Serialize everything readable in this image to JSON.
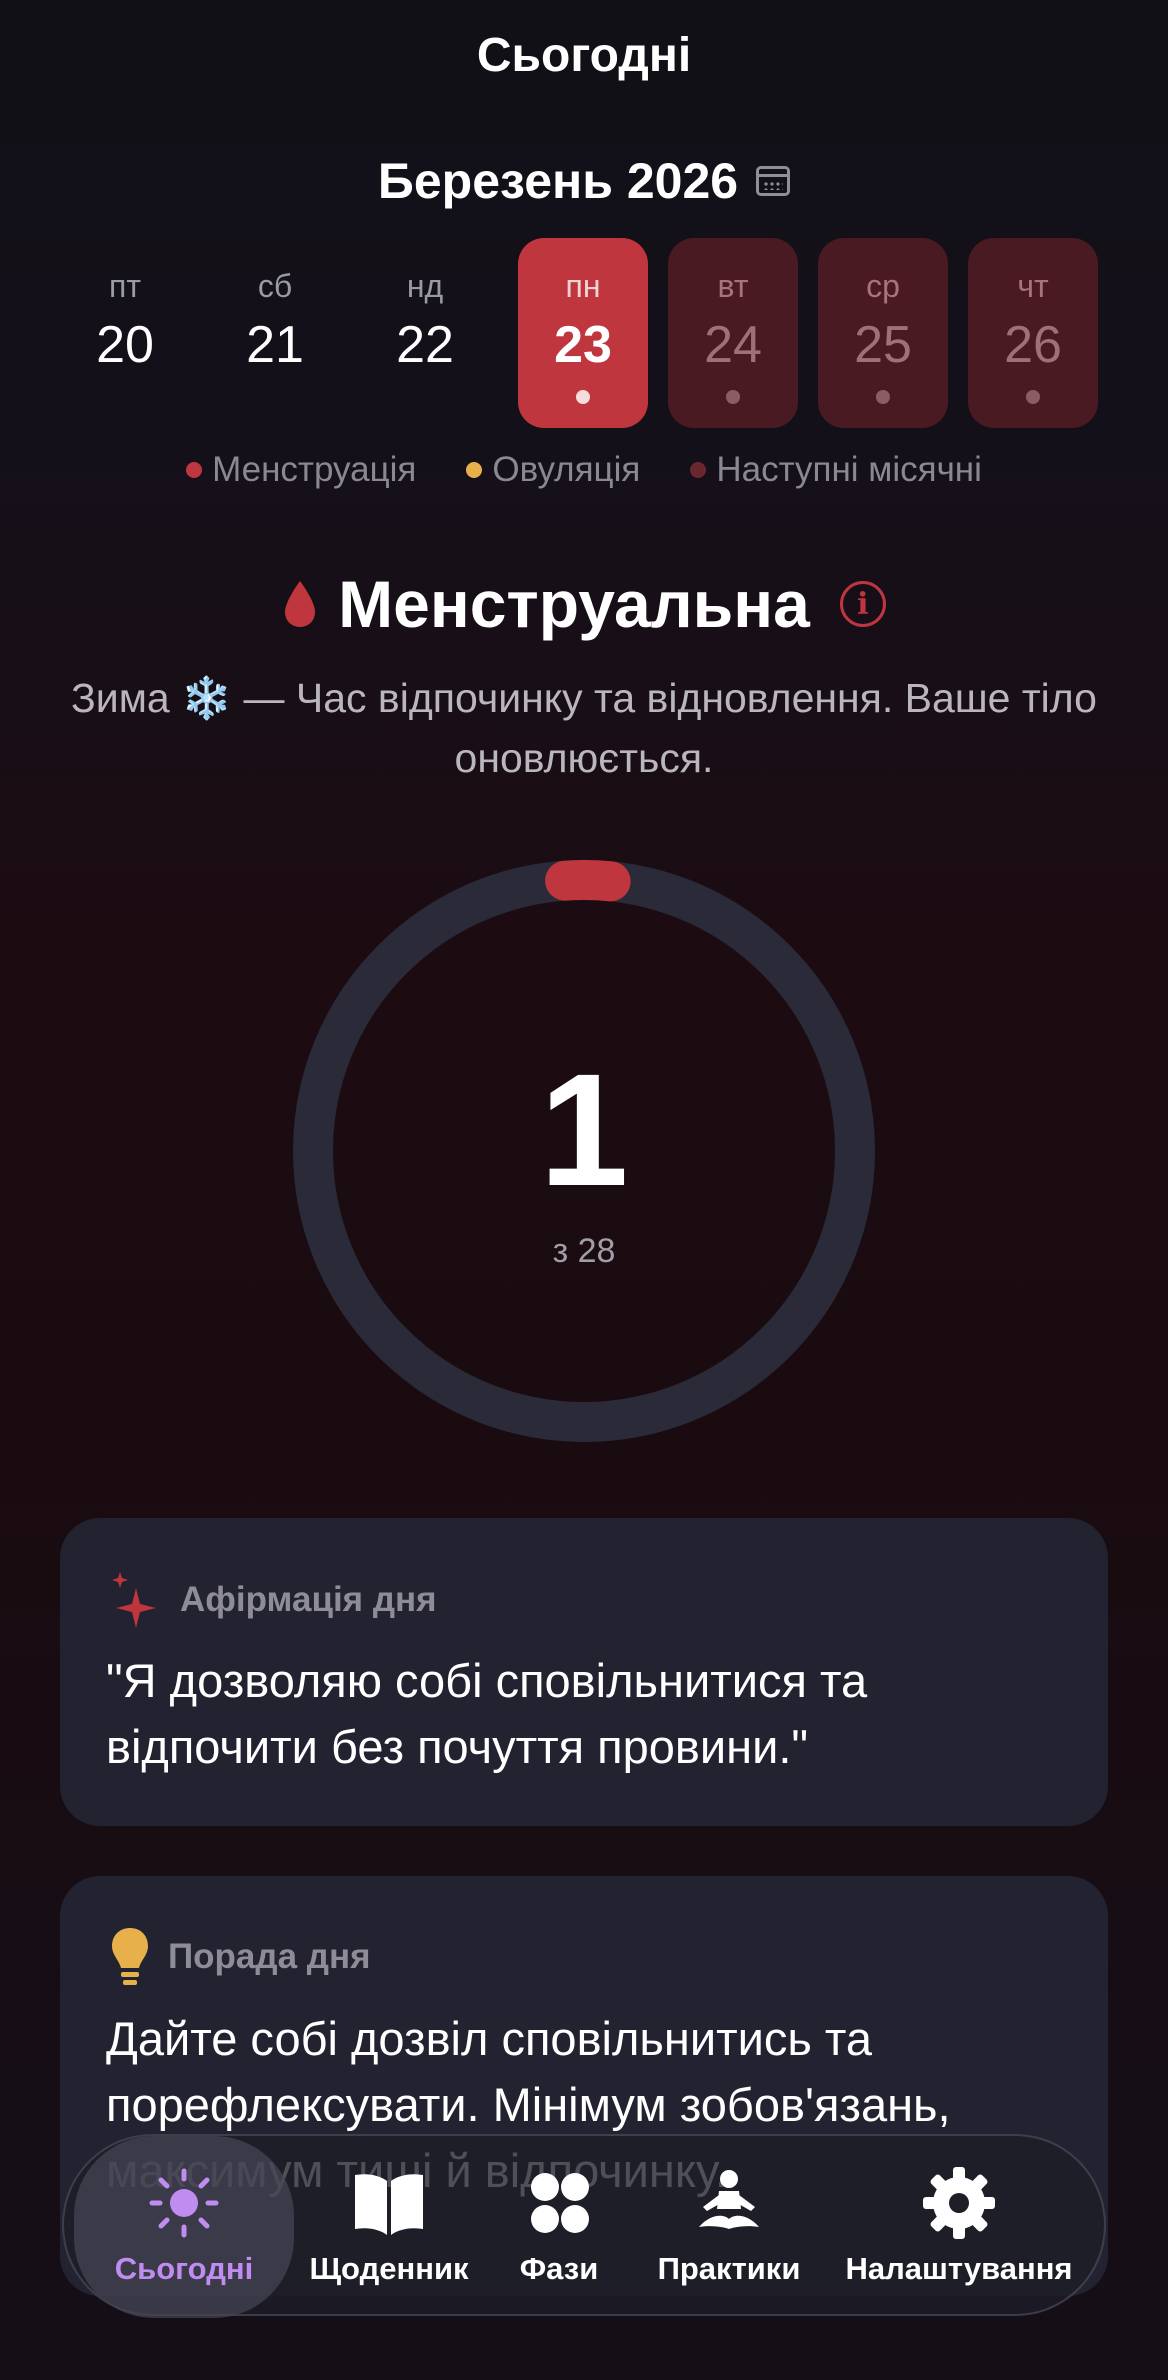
{
  "header": {
    "title": "Сьогодні"
  },
  "calendar": {
    "month": "Березень 2026",
    "days": [
      {
        "name": "пт",
        "date": "20",
        "state": "past"
      },
      {
        "name": "сб",
        "date": "21",
        "state": "past"
      },
      {
        "name": "нд",
        "date": "22",
        "state": "past"
      },
      {
        "name": "пн",
        "date": "23",
        "state": "selected"
      },
      {
        "name": "вт",
        "date": "24",
        "state": "next"
      },
      {
        "name": "ср",
        "date": "25",
        "state": "next"
      },
      {
        "name": "чт",
        "date": "26",
        "state": "next"
      }
    ],
    "legend": [
      {
        "label": "Менструація",
        "color": "#c0363f"
      },
      {
        "label": "Овуляція",
        "color": "#e8b04a"
      },
      {
        "label": "Наступні місячні",
        "color": "#6b2730"
      }
    ]
  },
  "phase": {
    "name": "Менструальна",
    "info_icon": "i",
    "description": "Зима ❄️ — Час відпочинку та відновлення. Ваше тіло оновлюється."
  },
  "cycle": {
    "day": "1",
    "total_label": "з 28",
    "day_value": 1,
    "total_days": 28,
    "color": "#c0363f"
  },
  "affirmation": {
    "heading": "Афірмація дня",
    "text": "\"Я дозволяю собі сповільнитися та відпочити без почуття провини.\""
  },
  "tip": {
    "heading": "Порада дня",
    "text": "Дайте собі дозвіл сповільнитись та порефлексувати. Мінімум зобов'язань, максимум тиші й відпочинку."
  },
  "nav": {
    "items": [
      {
        "label": "Сьогодні",
        "icon": "sun-icon",
        "active": true
      },
      {
        "label": "Щоденник",
        "icon": "book-icon",
        "active": false
      },
      {
        "label": "Фази",
        "icon": "circles-grid-icon",
        "active": false
      },
      {
        "label": "Практики",
        "icon": "meditation-icon",
        "active": false
      },
      {
        "label": "Налаштування",
        "icon": "gear-icon",
        "active": false
      }
    ]
  }
}
